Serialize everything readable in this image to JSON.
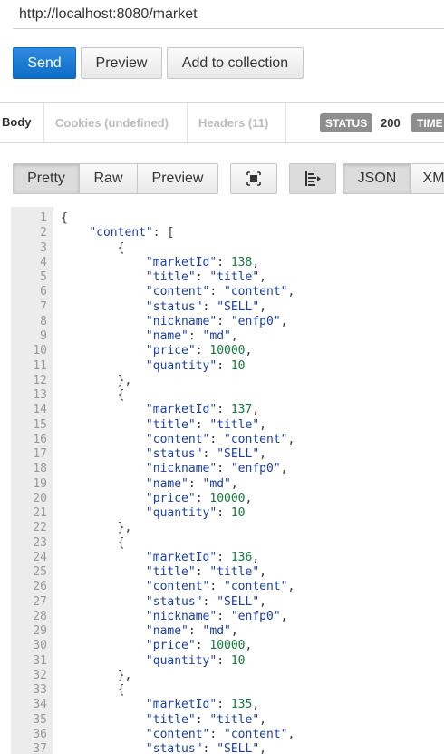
{
  "request": {
    "url": "http://localhost:8080/market",
    "send_label": "Send",
    "preview_label": "Preview",
    "add_collection_label": "Add to collection"
  },
  "response_tabs": {
    "body": "Body",
    "cookies": "Cookies (undefined)",
    "headers": "Headers (11)",
    "status_label": "STATUS",
    "status_code": "200",
    "time_label": "TIME"
  },
  "view_modes": {
    "pretty": "Pretty",
    "raw": "Raw",
    "preview": "Preview",
    "format_json": "JSON",
    "format_xml": "XML",
    "wrap_icon": "wrap-icon",
    "indent_icon": "indent-icon"
  },
  "colors": {
    "send_button": "#1a73c9",
    "json_key": "#1a3ea8",
    "json_number": "#117a3a",
    "badge": "#8e8e8e"
  },
  "code_lines": [
    "{",
    "    \"content\": [",
    "        {",
    "            \"marketId\": 138,",
    "            \"title\": \"title\",",
    "            \"content\": \"content\",",
    "            \"status\": \"SELL\",",
    "            \"nickname\": \"enfp0\",",
    "            \"name\": \"md\",",
    "            \"price\": 10000,",
    "            \"quantity\": 10",
    "        },",
    "        {",
    "            \"marketId\": 137,",
    "            \"title\": \"title\",",
    "            \"content\": \"content\",",
    "            \"status\": \"SELL\",",
    "            \"nickname\": \"enfp0\",",
    "            \"name\": \"md\",",
    "            \"price\": 10000,",
    "            \"quantity\": 10",
    "        },",
    "        {",
    "            \"marketId\": 136,",
    "            \"title\": \"title\",",
    "            \"content\": \"content\",",
    "            \"status\": \"SELL\",",
    "            \"nickname\": \"enfp0\",",
    "            \"name\": \"md\",",
    "            \"price\": 10000,",
    "            \"quantity\": 10",
    "        },",
    "        {",
    "            \"marketId\": 135,",
    "            \"title\": \"title\",",
    "            \"content\": \"content\",",
    "            \"status\": \"SELL\","
  ]
}
